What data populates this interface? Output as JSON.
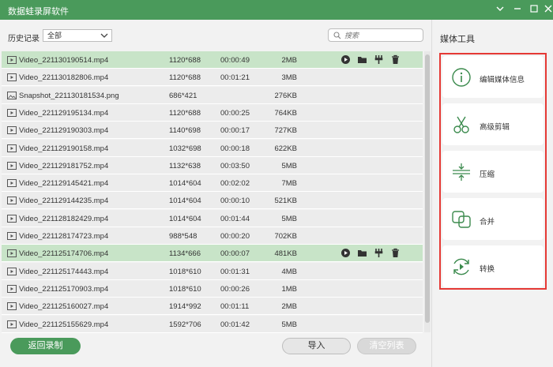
{
  "app": {
    "title": "数据蛙录屏软件"
  },
  "window_controls": {
    "settings_icon": "chevron-down-icon",
    "minimize_icon": "minimize-icon",
    "maximize_icon": "maximize-icon",
    "close_icon": "close-icon"
  },
  "history": {
    "label": "历史记录",
    "filter_value": "全部"
  },
  "search": {
    "placeholder": "搜索"
  },
  "files": [
    {
      "type": "video",
      "name": "Video_221130190514.mp4",
      "resolution": "1120*688",
      "duration": "00:00:49",
      "size": "2MB",
      "selected": true
    },
    {
      "type": "video",
      "name": "Video_221130182806.mp4",
      "resolution": "1120*688",
      "duration": "00:01:21",
      "size": "3MB",
      "selected": false
    },
    {
      "type": "image",
      "name": "Snapshot_221130181534.png",
      "resolution": "686*421",
      "duration": "",
      "size": "276KB",
      "selected": false
    },
    {
      "type": "video",
      "name": "Video_221129195134.mp4",
      "resolution": "1120*688",
      "duration": "00:00:25",
      "size": "764KB",
      "selected": false
    },
    {
      "type": "video",
      "name": "Video_221129190303.mp4",
      "resolution": "1140*698",
      "duration": "00:00:17",
      "size": "727KB",
      "selected": false
    },
    {
      "type": "video",
      "name": "Video_221129190158.mp4",
      "resolution": "1032*698",
      "duration": "00:00:18",
      "size": "622KB",
      "selected": false
    },
    {
      "type": "video",
      "name": "Video_221129181752.mp4",
      "resolution": "1132*638",
      "duration": "00:03:50",
      "size": "5MB",
      "selected": false
    },
    {
      "type": "video",
      "name": "Video_221129145421.mp4",
      "resolution": "1014*604",
      "duration": "00:02:02",
      "size": "7MB",
      "selected": false
    },
    {
      "type": "video",
      "name": "Video_221129144235.mp4",
      "resolution": "1014*604",
      "duration": "00:00:10",
      "size": "521KB",
      "selected": false
    },
    {
      "type": "video",
      "name": "Video_221128182429.mp4",
      "resolution": "1014*604",
      "duration": "00:01:44",
      "size": "5MB",
      "selected": false
    },
    {
      "type": "video",
      "name": "Video_221128174723.mp4",
      "resolution": "988*548",
      "duration": "00:00:20",
      "size": "702KB",
      "selected": false
    },
    {
      "type": "video",
      "name": "Video_221125174706.mp4",
      "resolution": "1134*666",
      "duration": "00:00:07",
      "size": "481KB",
      "selected": true
    },
    {
      "type": "video",
      "name": "Video_221125174443.mp4",
      "resolution": "1018*610",
      "duration": "00:01:31",
      "size": "4MB",
      "selected": false
    },
    {
      "type": "video",
      "name": "Video_221125170903.mp4",
      "resolution": "1018*610",
      "duration": "00:00:26",
      "size": "1MB",
      "selected": false
    },
    {
      "type": "video",
      "name": "Video_221125160027.mp4",
      "resolution": "1914*992",
      "duration": "00:01:11",
      "size": "2MB",
      "selected": false
    },
    {
      "type": "video",
      "name": "Video_221125155629.mp4",
      "resolution": "1592*706",
      "duration": "00:01:42",
      "size": "5MB",
      "selected": false
    }
  ],
  "row_actions": [
    "play-icon",
    "folder-icon",
    "edit-tools-icon",
    "delete-icon"
  ],
  "footer": {
    "back_label": "返回录制",
    "import_label": "导入",
    "clear_label": "清空列表"
  },
  "media_tools": {
    "heading": "媒体工具",
    "items": [
      {
        "label": "编辑媒体信息",
        "icon": "info-icon"
      },
      {
        "label": "高级剪辑",
        "icon": "scissors-icon"
      },
      {
        "label": "压缩",
        "icon": "compress-icon"
      },
      {
        "label": "合并",
        "icon": "merge-icon"
      },
      {
        "label": "转换",
        "icon": "convert-icon"
      }
    ]
  },
  "colors": {
    "accent": "#4a9a5b",
    "selected_row": "#c8e4c8",
    "highlight_frame": "#e53935"
  }
}
